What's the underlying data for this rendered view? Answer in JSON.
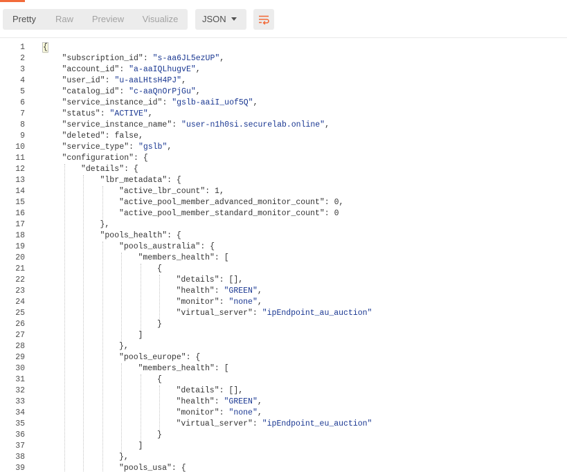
{
  "toolbar": {
    "tabs": [
      {
        "label": "Pretty",
        "active": true
      },
      {
        "label": "Raw",
        "active": false
      },
      {
        "label": "Preview",
        "active": false
      },
      {
        "label": "Visualize",
        "active": false
      }
    ],
    "format_select": {
      "selected": "JSON"
    },
    "wrap_icon": "wrap-lines-icon",
    "accent_color": "#f26b3a"
  },
  "editor": {
    "lines": [
      {
        "n": "1",
        "indent": 0,
        "parts": [
          [
            "p",
            "{"
          ]
        ]
      },
      {
        "n": "2",
        "indent": 1,
        "parts": [
          [
            "k",
            "\"subscription_id\""
          ],
          [
            "p",
            ": "
          ],
          [
            "s",
            "\"s-aa6JL5ezUP\""
          ],
          [
            "p",
            ","
          ]
        ]
      },
      {
        "n": "3",
        "indent": 1,
        "parts": [
          [
            "k",
            "\"account_id\""
          ],
          [
            "p",
            ": "
          ],
          [
            "s",
            "\"a-aaIQLhugvE\""
          ],
          [
            "p",
            ","
          ]
        ]
      },
      {
        "n": "4",
        "indent": 1,
        "parts": [
          [
            "k",
            "\"user_id\""
          ],
          [
            "p",
            ": "
          ],
          [
            "s",
            "\"u-aaLHtsH4PJ\""
          ],
          [
            "p",
            ","
          ]
        ]
      },
      {
        "n": "5",
        "indent": 1,
        "parts": [
          [
            "k",
            "\"catalog_id\""
          ],
          [
            "p",
            ": "
          ],
          [
            "s",
            "\"c-aaQnOrPjGu\""
          ],
          [
            "p",
            ","
          ]
        ]
      },
      {
        "n": "6",
        "indent": 1,
        "parts": [
          [
            "k",
            "\"service_instance_id\""
          ],
          [
            "p",
            ": "
          ],
          [
            "s",
            "\"gslb-aaiI_uof5Q\""
          ],
          [
            "p",
            ","
          ]
        ]
      },
      {
        "n": "7",
        "indent": 1,
        "parts": [
          [
            "k",
            "\"status\""
          ],
          [
            "p",
            ": "
          ],
          [
            "s",
            "\"ACTIVE\""
          ],
          [
            "p",
            ","
          ]
        ]
      },
      {
        "n": "8",
        "indent": 1,
        "parts": [
          [
            "k",
            "\"service_instance_name\""
          ],
          [
            "p",
            ": "
          ],
          [
            "s",
            "\"user-n1h0si.securelab.online\""
          ],
          [
            "p",
            ","
          ]
        ]
      },
      {
        "n": "9",
        "indent": 1,
        "parts": [
          [
            "k",
            "\"deleted\""
          ],
          [
            "p",
            ": "
          ],
          [
            "n",
            "false"
          ],
          [
            "p",
            ","
          ]
        ]
      },
      {
        "n": "10",
        "indent": 1,
        "parts": [
          [
            "k",
            "\"service_type\""
          ],
          [
            "p",
            ": "
          ],
          [
            "s",
            "\"gslb\""
          ],
          [
            "p",
            ","
          ]
        ]
      },
      {
        "n": "11",
        "indent": 1,
        "parts": [
          [
            "k",
            "\"configuration\""
          ],
          [
            "p",
            ": {"
          ]
        ]
      },
      {
        "n": "12",
        "indent": 2,
        "parts": [
          [
            "k",
            "\"details\""
          ],
          [
            "p",
            ": {"
          ]
        ]
      },
      {
        "n": "13",
        "indent": 3,
        "parts": [
          [
            "k",
            "\"lbr_metadata\""
          ],
          [
            "p",
            ": {"
          ]
        ]
      },
      {
        "n": "14",
        "indent": 4,
        "parts": [
          [
            "k",
            "\"active_lbr_count\""
          ],
          [
            "p",
            ": "
          ],
          [
            "n",
            "1"
          ],
          [
            "p",
            ","
          ]
        ]
      },
      {
        "n": "15",
        "indent": 4,
        "parts": [
          [
            "k",
            "\"active_pool_member_advanced_monitor_count\""
          ],
          [
            "p",
            ": "
          ],
          [
            "n",
            "0"
          ],
          [
            "p",
            ","
          ]
        ]
      },
      {
        "n": "16",
        "indent": 4,
        "parts": [
          [
            "k",
            "\"active_pool_member_standard_monitor_count\""
          ],
          [
            "p",
            ": "
          ],
          [
            "n",
            "0"
          ]
        ]
      },
      {
        "n": "17",
        "indent": 3,
        "parts": [
          [
            "p",
            "},"
          ]
        ]
      },
      {
        "n": "18",
        "indent": 3,
        "parts": [
          [
            "k",
            "\"pools_health\""
          ],
          [
            "p",
            ": {"
          ]
        ]
      },
      {
        "n": "19",
        "indent": 4,
        "parts": [
          [
            "k",
            "\"pools_australia\""
          ],
          [
            "p",
            ": {"
          ]
        ]
      },
      {
        "n": "20",
        "indent": 5,
        "parts": [
          [
            "k",
            "\"members_health\""
          ],
          [
            "p",
            ": ["
          ]
        ]
      },
      {
        "n": "21",
        "indent": 6,
        "parts": [
          [
            "p",
            "{"
          ]
        ]
      },
      {
        "n": "22",
        "indent": 7,
        "parts": [
          [
            "k",
            "\"details\""
          ],
          [
            "p",
            ": [],"
          ]
        ]
      },
      {
        "n": "23",
        "indent": 7,
        "parts": [
          [
            "k",
            "\"health\""
          ],
          [
            "p",
            ": "
          ],
          [
            "s",
            "\"GREEN\""
          ],
          [
            "p",
            ","
          ]
        ]
      },
      {
        "n": "24",
        "indent": 7,
        "parts": [
          [
            "k",
            "\"monitor\""
          ],
          [
            "p",
            ": "
          ],
          [
            "s",
            "\"none\""
          ],
          [
            "p",
            ","
          ]
        ]
      },
      {
        "n": "25",
        "indent": 7,
        "parts": [
          [
            "k",
            "\"virtual_server\""
          ],
          [
            "p",
            ": "
          ],
          [
            "s",
            "\"ipEndpoint_au_auction\""
          ]
        ]
      },
      {
        "n": "26",
        "indent": 6,
        "parts": [
          [
            "p",
            "}"
          ]
        ]
      },
      {
        "n": "27",
        "indent": 5,
        "parts": [
          [
            "p",
            "]"
          ]
        ]
      },
      {
        "n": "28",
        "indent": 4,
        "parts": [
          [
            "p",
            "},"
          ]
        ]
      },
      {
        "n": "29",
        "indent": 4,
        "parts": [
          [
            "k",
            "\"pools_europe\""
          ],
          [
            "p",
            ": {"
          ]
        ]
      },
      {
        "n": "30",
        "indent": 5,
        "parts": [
          [
            "k",
            "\"members_health\""
          ],
          [
            "p",
            ": ["
          ]
        ]
      },
      {
        "n": "31",
        "indent": 6,
        "parts": [
          [
            "p",
            "{"
          ]
        ]
      },
      {
        "n": "32",
        "indent": 7,
        "parts": [
          [
            "k",
            "\"details\""
          ],
          [
            "p",
            ": [],"
          ]
        ]
      },
      {
        "n": "33",
        "indent": 7,
        "parts": [
          [
            "k",
            "\"health\""
          ],
          [
            "p",
            ": "
          ],
          [
            "s",
            "\"GREEN\""
          ],
          [
            "p",
            ","
          ]
        ]
      },
      {
        "n": "34",
        "indent": 7,
        "parts": [
          [
            "k",
            "\"monitor\""
          ],
          [
            "p",
            ": "
          ],
          [
            "s",
            "\"none\""
          ],
          [
            "p",
            ","
          ]
        ]
      },
      {
        "n": "35",
        "indent": 7,
        "parts": [
          [
            "k",
            "\"virtual_server\""
          ],
          [
            "p",
            ": "
          ],
          [
            "s",
            "\"ipEndpoint_eu_auction\""
          ]
        ]
      },
      {
        "n": "36",
        "indent": 6,
        "parts": [
          [
            "p",
            "}"
          ]
        ]
      },
      {
        "n": "37",
        "indent": 5,
        "parts": [
          [
            "p",
            "]"
          ]
        ]
      },
      {
        "n": "38",
        "indent": 4,
        "parts": [
          [
            "p",
            "},"
          ]
        ]
      },
      {
        "n": "39",
        "indent": 4,
        "parts": [
          [
            "k",
            "\"pools_usa\""
          ],
          [
            "p",
            ": {"
          ]
        ]
      }
    ]
  }
}
